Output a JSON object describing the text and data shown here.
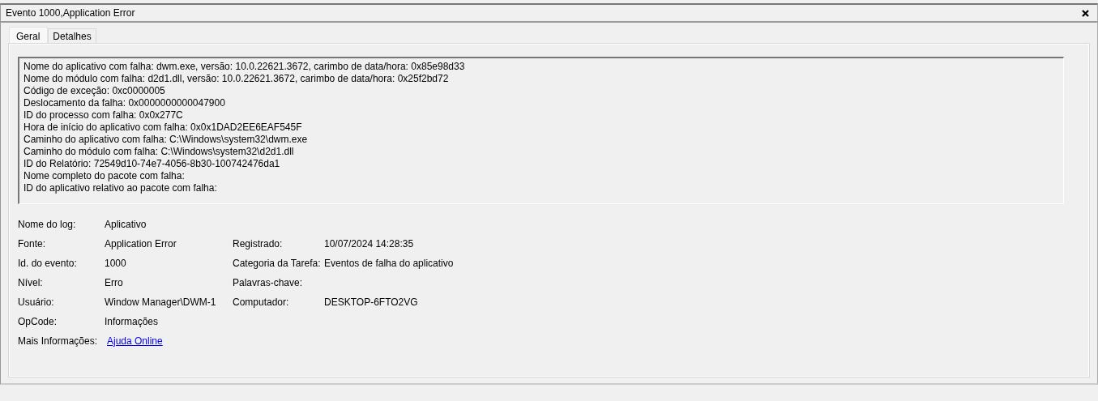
{
  "window": {
    "title": "Evento 1000,Application Error"
  },
  "tabs": [
    {
      "label": "Geral",
      "selected": true
    },
    {
      "label": "Detalhes",
      "selected": false
    }
  ],
  "description": {
    "lines": [
      "Nome do aplicativo com falha: dwm.exe, versão: 10.0.22621.3672, carimbo de data/hora: 0x85e98d33",
      "Nome do módulo com falha: d2d1.dll, versão: 10.0.22621.3672, carimbo de data/hora: 0x25f2bd72",
      "Código de exceção: 0xc0000005",
      "Deslocamento da falha: 0x0000000000047900",
      "ID do processo com falha: 0x0x277C",
      "Hora de início do aplicativo com falha: 0x0x1DAD2EE6EAF545F",
      "Caminho do aplicativo com falha: C:\\Windows\\system32\\dwm.exe",
      "Caminho do módulo com falha: C:\\Windows\\system32\\d2d1.dll",
      "ID do Relatório: 72549d10-74e7-4056-8b30-100742476da1",
      "Nome completo do pacote com falha:",
      "ID do aplicativo relativo ao pacote com falha:"
    ]
  },
  "properties": [
    {
      "label": "Nome do log:",
      "value": "Aplicativo",
      "kind": "text"
    },
    {
      "label": "Fonte:",
      "value": "Application Error",
      "kind": "text",
      "label_2": "Registrado:",
      "value_2": "10/07/2024 14:28:35"
    },
    {
      "label": "Id. do evento:",
      "value": "1000",
      "kind": "text",
      "label_2": "Categoria da Tarefa:",
      "value_2": "Eventos de falha do aplicativo"
    },
    {
      "label": "Nível:",
      "value": "Erro",
      "kind": "text",
      "label_2": "Palavras-chave:"
    },
    {
      "label": "Usuário:",
      "value": "Window Manager\\DWM-1",
      "kind": "text",
      "label_2": "Computador:",
      "value_2": "DESKTOP-6FTO2VG"
    },
    {
      "label": "OpCode:",
      "value": "Informações",
      "kind": "text"
    },
    {
      "label": "Mais Informações:",
      "value": "Ajuda Online",
      "kind": "link"
    }
  ]
}
